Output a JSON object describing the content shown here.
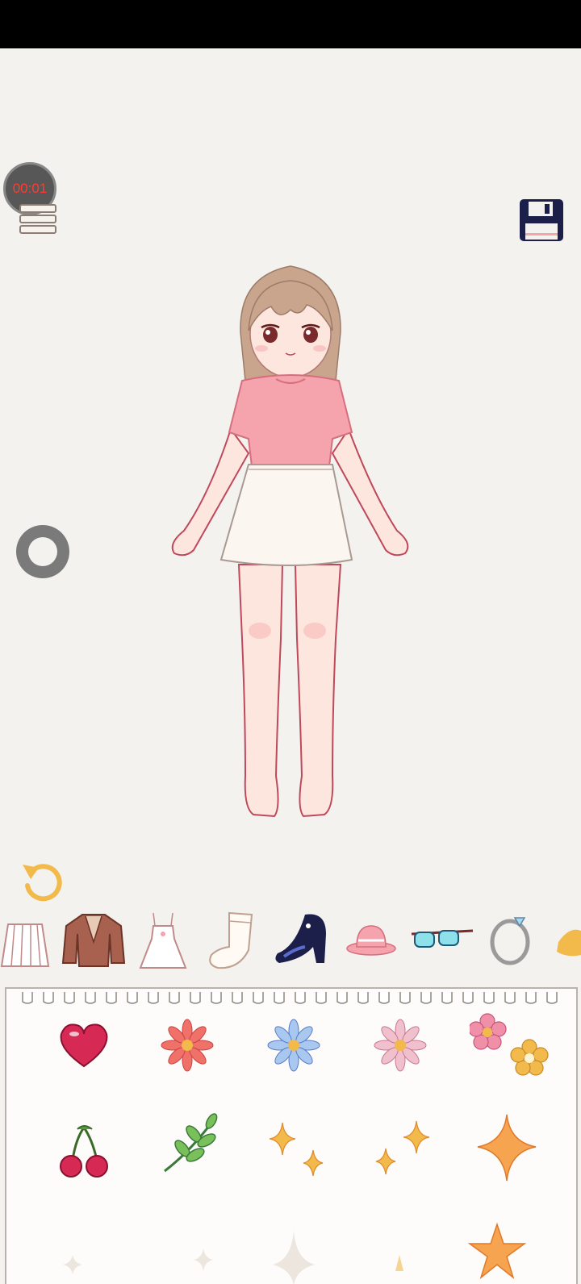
{
  "timer": {
    "text": "00:01"
  },
  "icons": {
    "menu": "menu-icon",
    "save": "save-icon",
    "record": "record-button",
    "undo": "undo-icon"
  },
  "categories": [
    {
      "name": "skirt",
      "icon": "pleated-skirt-icon"
    },
    {
      "name": "jacket",
      "icon": "jacket-icon"
    },
    {
      "name": "dress",
      "icon": "dress-icon"
    },
    {
      "name": "socks",
      "icon": "sock-icon"
    },
    {
      "name": "shoes",
      "icon": "shoe-icon",
      "selected": true
    },
    {
      "name": "hat",
      "icon": "hat-icon"
    },
    {
      "name": "glasses",
      "icon": "glasses-icon"
    },
    {
      "name": "ring",
      "icon": "ring-icon"
    },
    {
      "name": "more",
      "icon": "partial-item-icon"
    }
  ],
  "stickers": [
    "heart-sticker",
    "red-flower-sticker",
    "blue-flower-sticker",
    "pink-flower-sticker",
    "two-flowers-sticker",
    "cherry-sticker",
    "leaf-sticker",
    "sparkle-pair-sticker",
    "sparkle-pair-2-sticker",
    "big-sparkle-sticker"
  ],
  "colors": {
    "background": "#f3f2ee",
    "timer_text": "#ff3b30",
    "save_icon": "#1b1f4a",
    "undo_icon": "#f2b94b",
    "shirt": "#f5a3ad",
    "skirt": "#fbf7f0",
    "hair": "#c9a58e"
  }
}
